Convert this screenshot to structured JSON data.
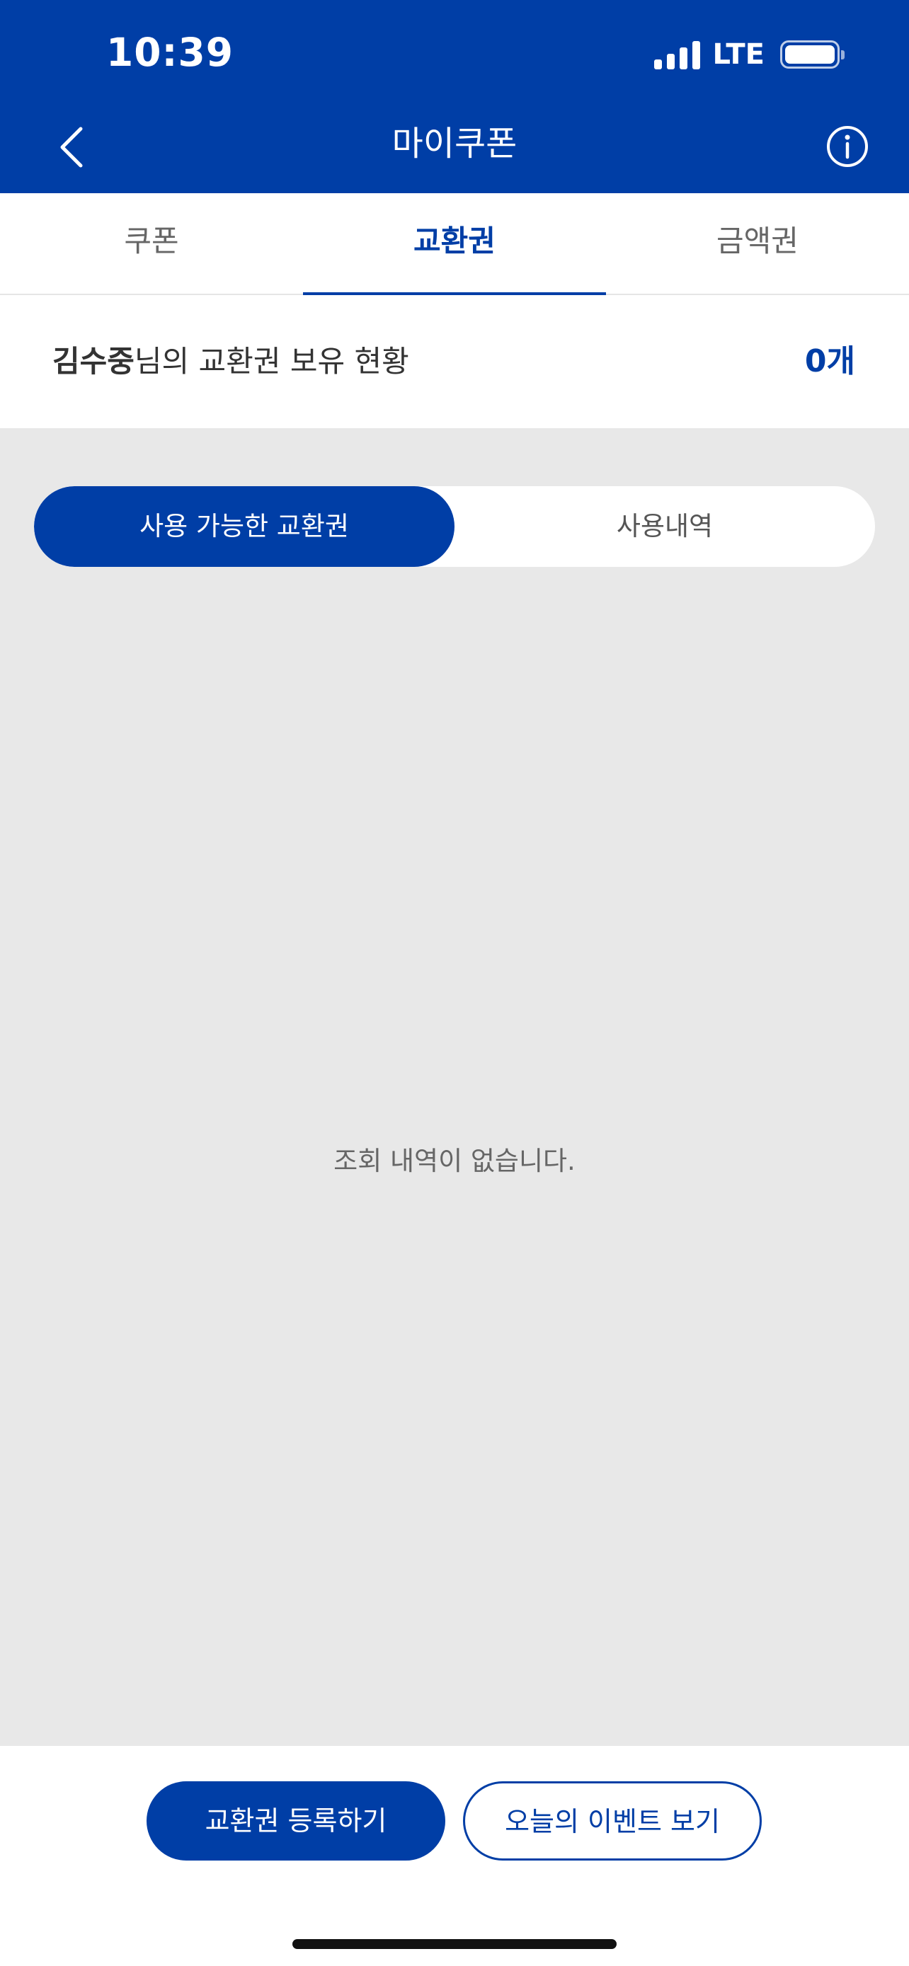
{
  "status_bar": {
    "time": "10:39",
    "network": "LTE",
    "icons": [
      "signal-bars-icon",
      "battery-icon"
    ]
  },
  "nav": {
    "title": "마이쿠폰",
    "back_icon": "chevron-left-icon",
    "info_icon": "info-circle-icon"
  },
  "tabs": [
    {
      "label": "쿠폰",
      "active": false
    },
    {
      "label": "교환권",
      "active": true
    },
    {
      "label": "금액권",
      "active": false
    }
  ],
  "summary": {
    "user_name": "김수중",
    "text_suffix": "님의 교환권 보유 현황",
    "count": "0개"
  },
  "segment": {
    "available_label": "사용 가능한 교환권",
    "history_label": "사용내역",
    "selected": "available"
  },
  "empty_message": "조회 내역이 없습니다.",
  "actions": {
    "register_label": "교환권 등록하기",
    "events_label": "오늘의 이벤트 보기"
  },
  "colors": {
    "brand": "#003ea6",
    "content_bg": "#e8e8e8"
  }
}
